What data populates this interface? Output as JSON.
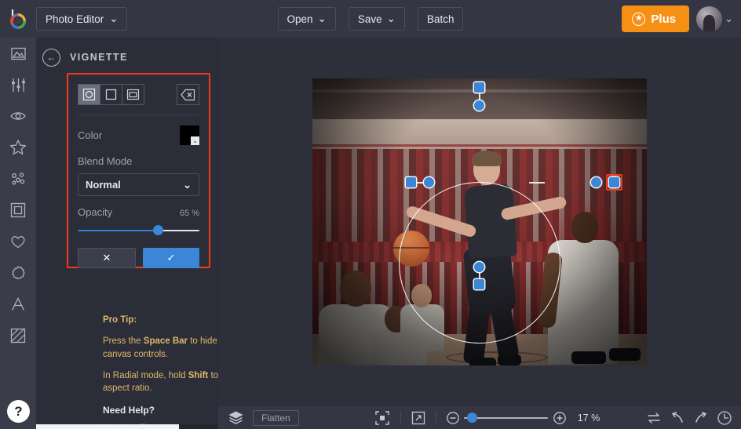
{
  "app": {
    "logo_name": "rainbow-ring-logo",
    "title": "Photo Editor",
    "title_chevron": "⌄"
  },
  "topbar": {
    "buttons": [
      {
        "label": "Open",
        "has_chevron": true,
        "name": "open-button"
      },
      {
        "label": "Save",
        "has_chevron": true,
        "name": "save-button"
      },
      {
        "label": "Batch",
        "has_chevron": false,
        "name": "batch-button"
      }
    ],
    "plus": {
      "label": "Plus",
      "icon": "star-icon",
      "color": "#f59015"
    },
    "avatar_chevron": "⌄"
  },
  "rail": {
    "items": [
      {
        "name": "sidebar-item-image",
        "icon": "image-icon"
      },
      {
        "name": "sidebar-item-adjust",
        "icon": "sliders-icon"
      },
      {
        "name": "sidebar-item-effects",
        "icon": "eye-icon"
      },
      {
        "name": "sidebar-item-overlays",
        "icon": "star-outline-icon"
      },
      {
        "name": "sidebar-item-retouch",
        "icon": "dots-cluster-icon"
      },
      {
        "name": "sidebar-item-frames",
        "icon": "square-frame-icon"
      },
      {
        "name": "sidebar-item-favorites",
        "icon": "heart-icon"
      },
      {
        "name": "sidebar-item-stickers",
        "icon": "badge-icon"
      },
      {
        "name": "sidebar-item-text",
        "icon": "letter-a-icon"
      },
      {
        "name": "sidebar-item-textures",
        "icon": "hatched-square-icon"
      }
    ],
    "help_label": "?"
  },
  "panel": {
    "back_icon": "←",
    "title": "VIGNETTE",
    "shapes": [
      {
        "name": "shape-radial",
        "icon": "circle-in-square-icon",
        "selected": true
      },
      {
        "name": "shape-rectangle",
        "icon": "square-icon",
        "selected": false
      },
      {
        "name": "shape-frame",
        "icon": "inner-frame-icon",
        "selected": false
      }
    ],
    "erase_icon": "erase-icon",
    "color_label": "Color",
    "color_value": "#000000",
    "blend_label": "Blend Mode",
    "blend_value": "Normal",
    "blend_chevron": "⌄",
    "opacity_label": "Opacity",
    "opacity_value": "65 %",
    "opacity_percent": 65,
    "cancel_icon": "✕",
    "apply_icon": "✓",
    "accent_blue": "#3c86d8",
    "highlight_color": "#f03a17"
  },
  "tips": {
    "heading": "Pro Tip:",
    "line1_a": "Press the ",
    "line1_b": "Space Bar",
    "line1_c": " to hide the on-canvas controls.",
    "line2_a": "In Radial mode, hold ",
    "line2_b": "Shift",
    "line2_c": " to lock the aspect ratio.",
    "need_help": "Need Help?",
    "tutorial_link": "Here's a Tutorial"
  },
  "canvas": {
    "overlay_shape": "radial-vignette-ring",
    "selected_handle": "right-size-handle"
  },
  "bottombar": {
    "layers_icon": "layers-icon",
    "flatten_label": "Flatten",
    "fit_icon": "fit-to-screen-icon",
    "expand_icon": "expand-icon",
    "zoom_out": "−",
    "zoom_in": "+",
    "zoom_level": "17 %",
    "compare_icon": "compare-icon",
    "undo_icon": "undo-icon",
    "redo_icon": "redo-icon",
    "history_icon": "history-clock-icon"
  }
}
